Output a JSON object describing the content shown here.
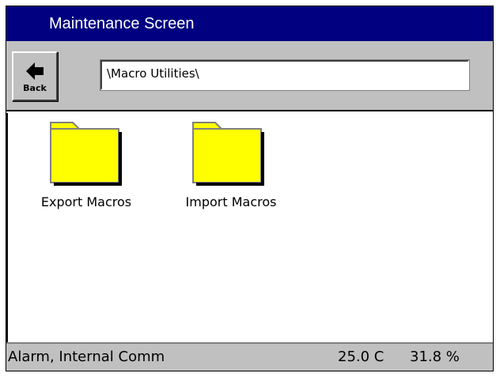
{
  "window": {
    "title": "Maintenance Screen"
  },
  "toolbar": {
    "back_label": "Back",
    "back_icon": "arrow-left-icon",
    "path_value": "\\Macro Utilities\\"
  },
  "folders": [
    {
      "label": "Export Macros",
      "icon": "folder-icon"
    },
    {
      "label": "Import Macros",
      "icon": "folder-icon"
    }
  ],
  "status": {
    "alarm": "Alarm, Internal Comm",
    "temperature": "25.0 C",
    "humidity": "31.8 %"
  },
  "colors": {
    "title_bar": "#000080",
    "folder_fill": "#ffff00",
    "chrome": "#c0c0c0"
  }
}
